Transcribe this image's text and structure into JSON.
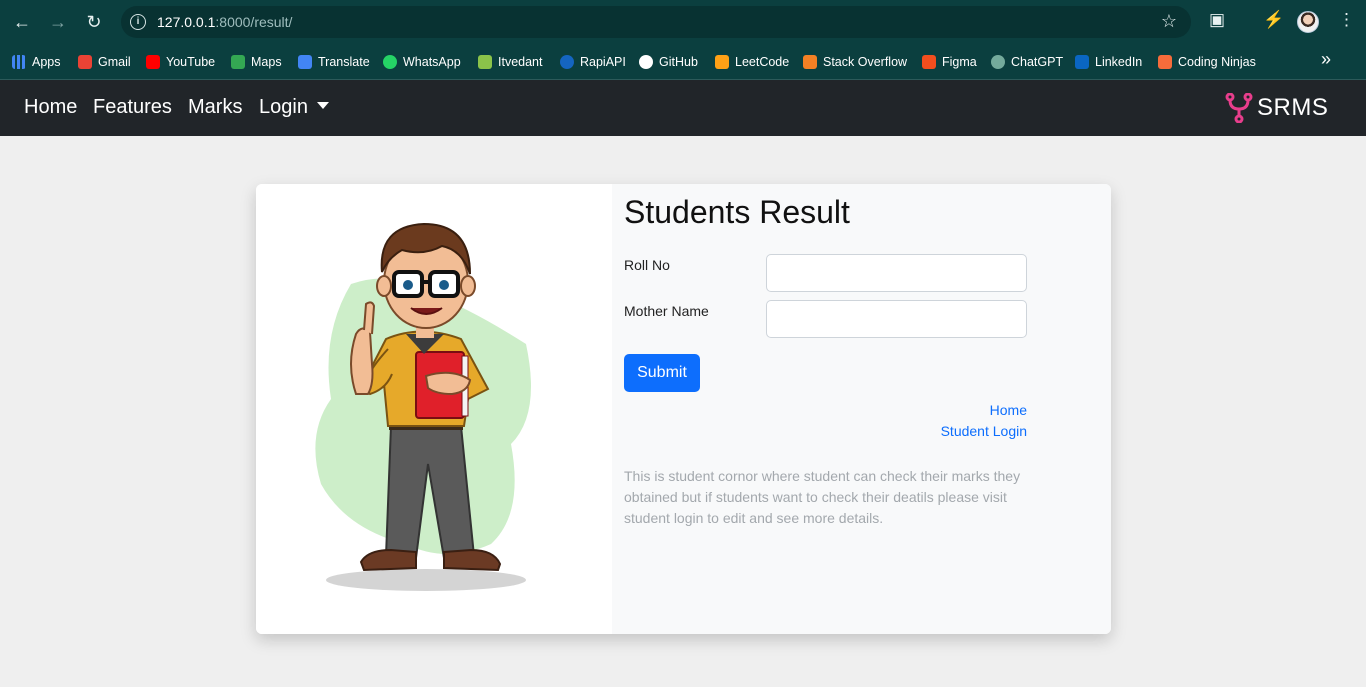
{
  "browser": {
    "url_host": "127.0.0.1",
    "url_rest": ":8000/result/",
    "bookmarks": [
      {
        "label": "Apps",
        "color": "#4285f4"
      },
      {
        "label": "Gmail",
        "color": "#ea4335"
      },
      {
        "label": "YouTube",
        "color": "#ff0000"
      },
      {
        "label": "Maps",
        "color": "#34a853"
      },
      {
        "label": "Translate",
        "color": "#4285f4"
      },
      {
        "label": "WhatsApp",
        "color": "#25d366"
      },
      {
        "label": "Itvedant",
        "color": "#8bc34a"
      },
      {
        "label": "RapiAPI",
        "color": "#1565c0"
      },
      {
        "label": "GitHub",
        "color": "#ffffff"
      },
      {
        "label": "LeetCode",
        "color": "#ffa116"
      },
      {
        "label": "Stack Overflow",
        "color": "#f48024"
      },
      {
        "label": "Figma",
        "color": "#f24e1e"
      },
      {
        "label": "ChatGPT",
        "color": "#74aa9c"
      },
      {
        "label": "LinkedIn",
        "color": "#0a66c2"
      },
      {
        "label": "Coding Ninjas",
        "color": "#f66c3b"
      }
    ],
    "more_label": "»"
  },
  "navbar": {
    "links": [
      "Home",
      "Features",
      "Marks",
      "Login"
    ],
    "brand": "SRMS",
    "brand_color": "#e83e8c"
  },
  "form": {
    "title": "Students Result",
    "roll_label": "Roll No",
    "mother_label": "Mother Name",
    "submit_label": "Submit",
    "home_link": "Home",
    "student_login_link": "Student Login",
    "description": "This is student cornor where student can check their marks they obtained but if students want to check their deatils please visit student login to edit and see more details."
  }
}
